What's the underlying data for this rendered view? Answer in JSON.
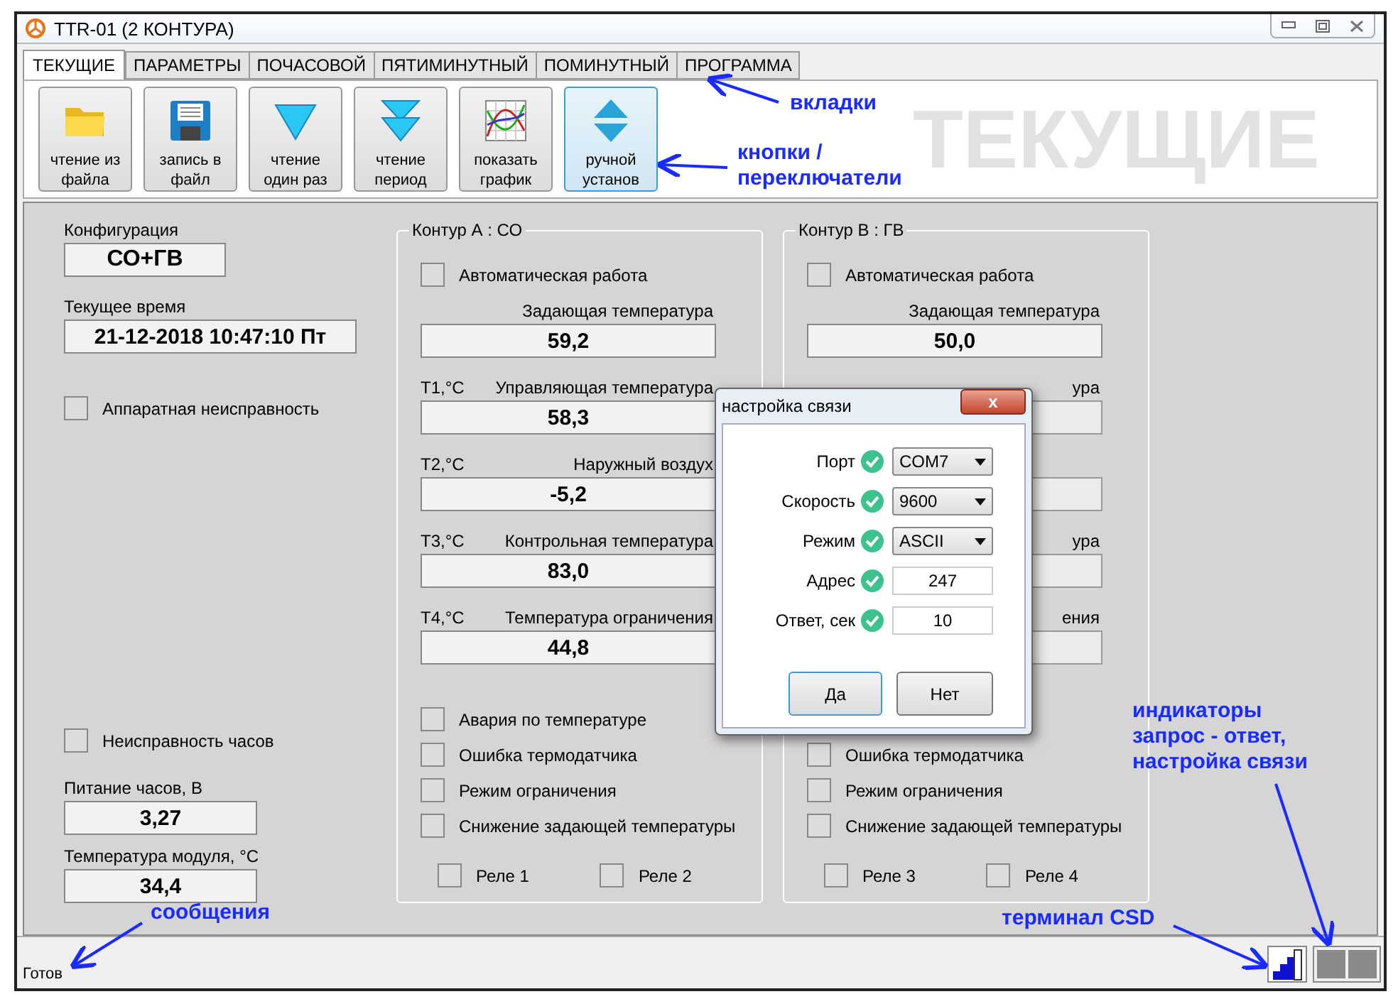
{
  "window": {
    "title": "TTR-01 (2 КОНТУРА)"
  },
  "tabs": [
    {
      "label": "ТЕКУЩИЕ",
      "selected": true
    },
    {
      "label": "ПАРАМЕТРЫ",
      "selected": false
    },
    {
      "label": "ПОЧАСОВОЙ",
      "selected": false
    },
    {
      "label": "ПЯТИМИНУТНЫЙ",
      "selected": false
    },
    {
      "label": "ПОМИНУТНЫЙ",
      "selected": false
    },
    {
      "label": "ПРОГРАММА",
      "selected": false
    }
  ],
  "toolbar": [
    {
      "kind": "open",
      "label": "чтение из\nфайла",
      "selected": false
    },
    {
      "kind": "save",
      "label": "запись в\nфайл",
      "selected": false
    },
    {
      "kind": "once",
      "label": "чтение\nодин раз",
      "selected": false
    },
    {
      "kind": "period",
      "label": "чтение\nпериод",
      "selected": false
    },
    {
      "kind": "chart",
      "label": "показать\nграфик",
      "selected": false
    },
    {
      "kind": "manual",
      "label": "ручной\nустанов",
      "selected": true
    }
  ],
  "page_banner": "ТЕКУЩИЕ",
  "general": {
    "config": {
      "label": "Конфигурация",
      "value": "СО+ГВ"
    },
    "time": {
      "label": "Текущее время",
      "value": "21-12-2018 10:47:10 Пт"
    },
    "hardware_fault": {
      "label": "Аппаратная неисправность",
      "checked": false
    },
    "clock_fault": {
      "label": "Неисправность часов",
      "checked": false
    },
    "readings": [
      {
        "label": "Питание часов, В",
        "value": "3,27"
      },
      {
        "label": "Температура модуля, °С",
        "value": "34,4"
      }
    ]
  },
  "contours": [
    {
      "title": "Контур А : СО",
      "auto": {
        "label": "Автоматическая работа",
        "checked": false
      },
      "fields": [
        {
          "label": "Задающая температура",
          "value": "59,2"
        },
        {
          "tag": "Т1,°С",
          "label": "Управляющая температура",
          "value": "58,3"
        },
        {
          "tag": "Т2,°С",
          "label": "Наружный воздух",
          "value": "-5,2"
        },
        {
          "tag": "Т3,°С",
          "label": "Контрольная температура",
          "value": "83,0"
        },
        {
          "tag": "Т4,°С",
          "label": "Температура ограничения",
          "value": "44,8"
        }
      ],
      "flags": [
        {
          "label": "Авария по температуре",
          "checked": false
        },
        {
          "label": "Ошибка термодатчика",
          "checked": false
        },
        {
          "label": "Режим ограничения",
          "checked": false
        },
        {
          "label": "Снижение задающей температуры",
          "checked": false
        }
      ],
      "relays": [
        {
          "label": "Реле 1",
          "checked": false
        },
        {
          "label": "Реле 2",
          "checked": false
        }
      ]
    },
    {
      "title": "Контур В : ГВ",
      "auto": {
        "label": "Автоматическая работа",
        "checked": false
      },
      "fields": [
        {
          "label": "Задающая температура",
          "value": "50,0"
        },
        {
          "label": "ура",
          "covered": true
        },
        {
          "covered": true
        },
        {
          "label": "ура",
          "covered": true
        },
        {
          "label": "ения",
          "covered": true
        }
      ],
      "flags": [
        {
          "hidden": true
        },
        {
          "label": "Ошибка термодатчика",
          "checked": false
        },
        {
          "label": "Режим ограничения",
          "checked": false
        },
        {
          "label": "Снижение задающей температуры",
          "checked": false
        }
      ],
      "relays": [
        {
          "label": "Реле 3",
          "checked": false
        },
        {
          "label": "Реле 4",
          "checked": false
        }
      ]
    }
  ],
  "dialog": {
    "title": "настройка связи",
    "close": "x",
    "rows": [
      {
        "label": "Порт",
        "ok": true,
        "kind": "select",
        "value": "COM7"
      },
      {
        "label": "Скорость",
        "ok": true,
        "kind": "select",
        "value": "9600"
      },
      {
        "label": "Режим",
        "ok": true,
        "kind": "select",
        "value": "ASCII"
      },
      {
        "label": "Адрес",
        "ok": true,
        "kind": "input",
        "value": "247"
      },
      {
        "label": "Ответ, сек",
        "ok": true,
        "kind": "input",
        "value": "10"
      }
    ],
    "buttons": [
      {
        "label": "Да",
        "selected": true
      },
      {
        "label": "Нет",
        "selected": false
      }
    ]
  },
  "status_bar": {
    "message": "Готов"
  },
  "annotations": [
    "вкладки",
    "кнопки /\nпереключатели",
    "сообщения",
    "терминал CSD",
    "индикаторы\nзапрос - ответ,\nнастройка связи"
  ]
}
